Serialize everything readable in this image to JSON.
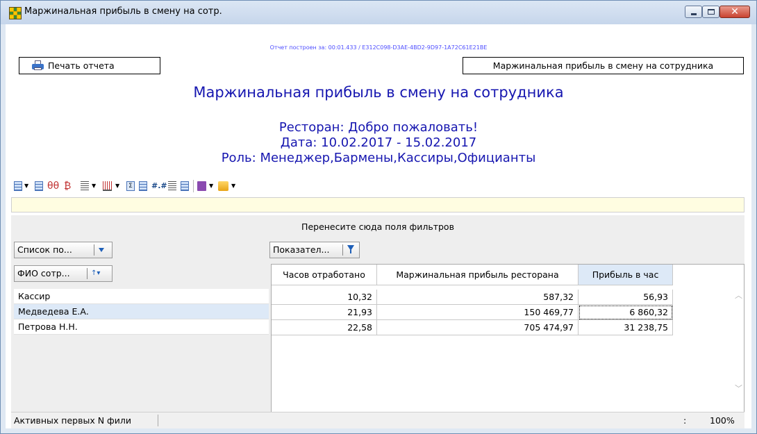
{
  "window": {
    "title": "Маржинальная прибыль в смену на сотр.",
    "close_symbol": "✕"
  },
  "report": {
    "generated_text": "Отчет построен за: 00:01.433 / E312C098-D3AE-4BD2-9D97-1A72C61E21BE",
    "print_button_label": "Печать отчета",
    "header_button_label": "Маржинальная прибыль в смену на сотрудника",
    "title": "Маржинальная прибыль в смену на сотрудника",
    "restaurant_line": "Ресторан: Добро пожаловать!",
    "date_line": "Дата: 10.02.2017 - 15.02.2017",
    "role_line": "Роль: Менеджер,Бармены,Кассиры,Официанты"
  },
  "toolbar": {
    "icons": [
      "layout-icon",
      "dropdown-arrow-icon",
      "grid-icon",
      "hide-icon",
      "currency-icon",
      "rows-icon",
      "columns-icon",
      "sum-icon",
      "chart-icon",
      "format-icon",
      "text-icon",
      "info-icon",
      "save-icon",
      "open-folder-icon"
    ],
    "format_glyph": "#.#",
    "sym_hide": "θθ",
    "sym_currency": "₿",
    "arrow": "▼"
  },
  "pivot": {
    "drop_hint": "Перенесите сюда поля фильтров",
    "field_rows_label": "Список по...",
    "field_data_label": "Показател...",
    "field_fio_label": "ФИО сотр...",
    "sort_glyph": "↑▾",
    "columns": [
      "Часов отработано",
      "Маржинальная прибыль ресторана",
      "Прибыль в час"
    ],
    "rows": [
      {
        "name": "Кассир",
        "hours": "10,32",
        "margin": "587,32",
        "per_hour": "56,93"
      },
      {
        "name": "Медведева Е.А.",
        "hours": "21,93",
        "margin": "150 469,77",
        "per_hour": "6 860,32"
      },
      {
        "name": "Петрова Н.Н.",
        "hours": "22,58",
        "margin": "705 474,97",
        "per_hour": "31 238,75"
      }
    ]
  },
  "status": {
    "left_text": "Активных первых N фили",
    "colon": ":",
    "zoom": "100%"
  },
  "colors": {
    "title_blue": "#1616b0",
    "link_blue": "#4d4dff",
    "selection": "#dde9f7",
    "filter_bar": "#fffde1"
  }
}
